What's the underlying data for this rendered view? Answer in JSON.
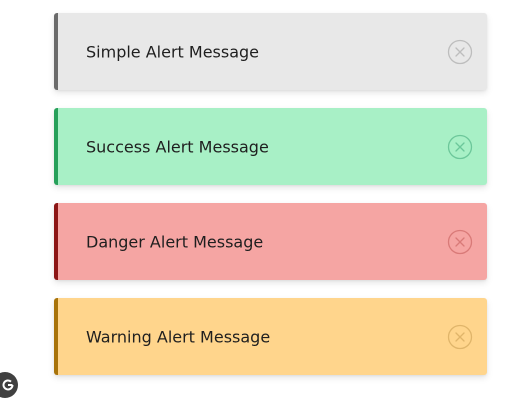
{
  "alerts": [
    {
      "type": "simple",
      "message": "Simple Alert Message",
      "close_icon": "close-circle-icon",
      "color": "#e8e8e8",
      "accent": "#6b6b6b"
    },
    {
      "type": "success",
      "message": "Success Alert Message",
      "close_icon": "close-circle-icon",
      "color": "#a8f0c6",
      "accent": "#27a05a"
    },
    {
      "type": "danger",
      "message": "Danger Alert Message",
      "close_icon": "close-circle-icon",
      "color": "#f5a5a3",
      "accent": "#8c1616"
    },
    {
      "type": "warning",
      "message": "Warning Alert Message",
      "close_icon": "close-circle-icon",
      "color": "#ffd58c",
      "accent": "#a8730a"
    }
  ],
  "corner_badge": {
    "icon": "google-g-icon"
  }
}
